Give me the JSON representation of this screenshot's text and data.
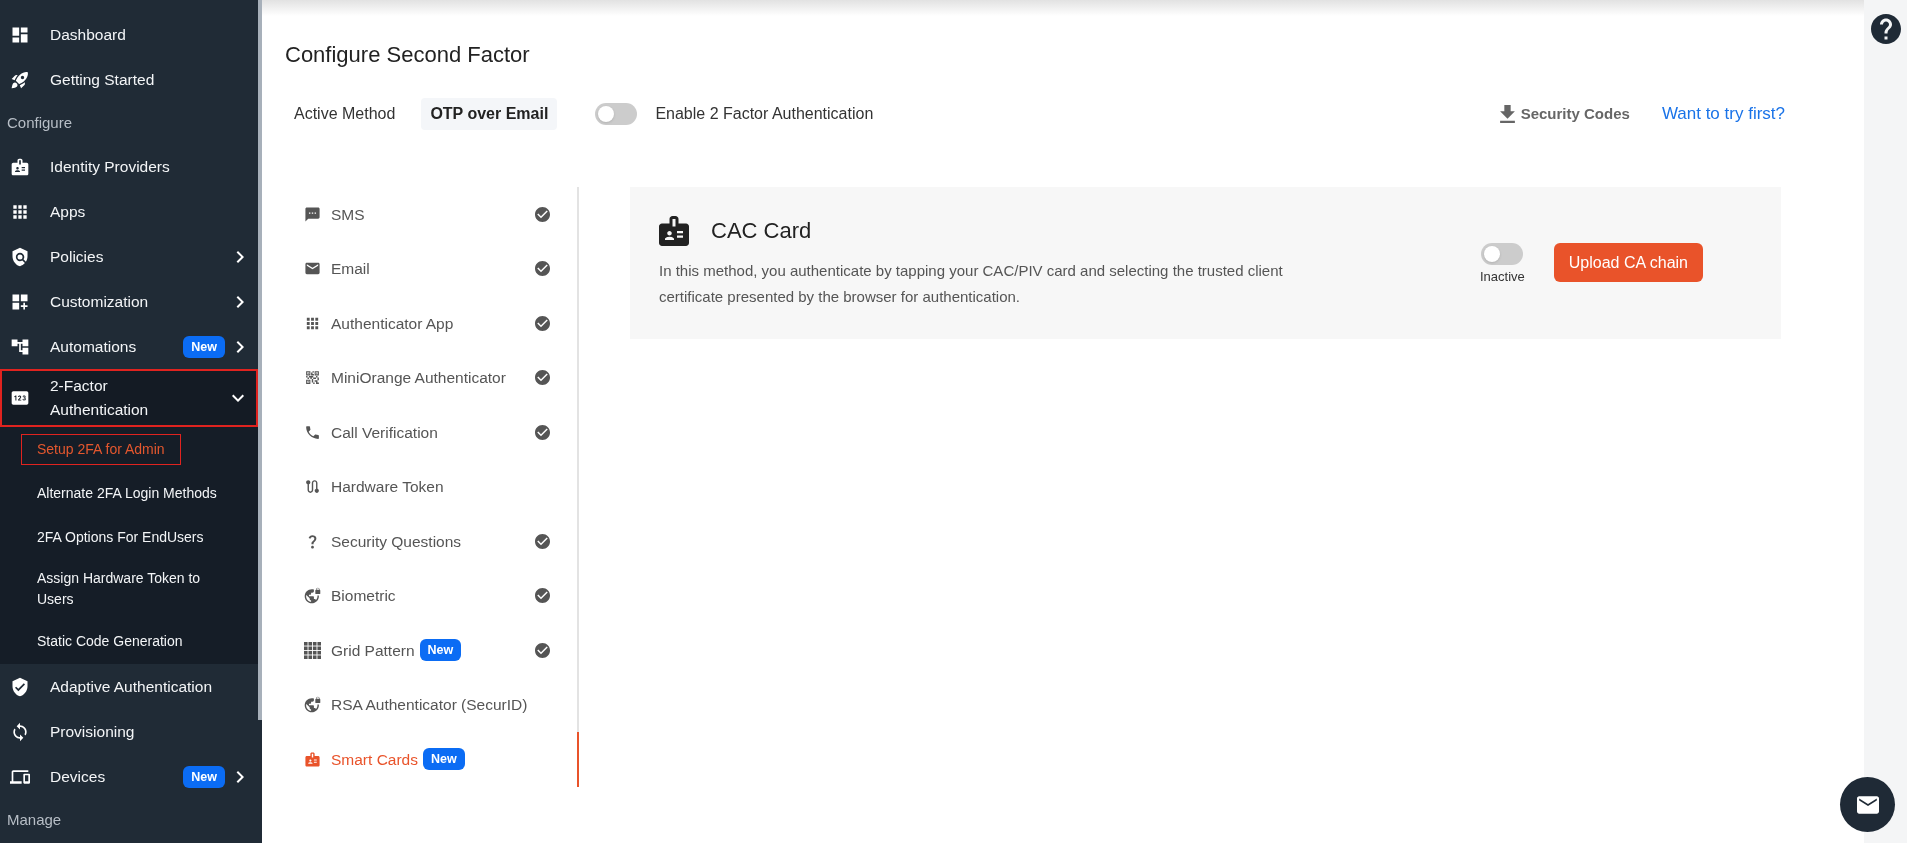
{
  "sidebar": {
    "items": [
      {
        "kind": "link",
        "label": "Dashboard",
        "selected": false
      },
      {
        "kind": "link",
        "label": "Getting Started",
        "selected": false
      },
      {
        "kind": "heading",
        "label": "Configure"
      },
      {
        "kind": "link",
        "label": "Identity Providers",
        "selected": false
      },
      {
        "kind": "link",
        "label": "Apps",
        "selected": false
      },
      {
        "kind": "group",
        "label": "Policies",
        "selected": false,
        "expanded": false
      },
      {
        "kind": "group",
        "label": "Customization",
        "selected": false,
        "expanded": false
      },
      {
        "kind": "group",
        "label": "Automations",
        "badge": "New",
        "selected": false,
        "expanded": false
      },
      {
        "kind": "group",
        "label": "2-Factor Authentication",
        "selected": true,
        "expanded": true,
        "children": [
          {
            "label": "Setup 2FA for Admin",
            "selected": true
          },
          {
            "label": "Alternate 2FA Login Methods",
            "selected": false
          },
          {
            "label": "2FA Options For EndUsers",
            "selected": false
          },
          {
            "label": "Assign Hardware Token to Users",
            "selected": false
          },
          {
            "label": "Static Code Generation",
            "selected": false
          }
        ]
      },
      {
        "kind": "link",
        "label": "Adaptive Authentication",
        "selected": false
      },
      {
        "kind": "link",
        "label": "Provisioning",
        "selected": false
      },
      {
        "kind": "group",
        "label": "Devices",
        "badge": "New",
        "selected": false,
        "expanded": false
      },
      {
        "kind": "heading",
        "label": "Manage"
      }
    ]
  },
  "page": {
    "title": "Configure Second Factor",
    "active_method": {
      "label": "Active Method",
      "value": "OTP over Email"
    },
    "enable_2fa": {
      "label": "Enable 2 Factor Authentication",
      "on": false
    },
    "security_codes": "Security Codes",
    "try_link": "Want to try first?"
  },
  "methods": [
    {
      "label": "SMS",
      "configured": true,
      "selected": false
    },
    {
      "label": "Email",
      "configured": true,
      "selected": false
    },
    {
      "label": "Authenticator App",
      "configured": true,
      "selected": false
    },
    {
      "label": "MiniOrange Authenticator",
      "configured": true,
      "selected": false
    },
    {
      "label": "Call Verification",
      "configured": true,
      "selected": false
    },
    {
      "label": "Hardware Token",
      "configured": false,
      "selected": false
    },
    {
      "label": "Security Questions",
      "configured": true,
      "selected": false
    },
    {
      "label": "Biometric",
      "configured": true,
      "selected": false
    },
    {
      "label": "Grid Pattern",
      "badge": "New",
      "configured": true,
      "selected": false
    },
    {
      "label": "RSA Authenticator (SecurID)",
      "configured": false,
      "selected": false
    },
    {
      "label": "Smart Cards",
      "badge": "New",
      "configured": false,
      "selected": true
    }
  ],
  "card": {
    "title": "CAC Card",
    "description": "In this method, you authenticate by tapping your CAC/PIV card and selecting the trusted client certificate presented by the browser for authentication.",
    "status": {
      "on": false,
      "label": "Inactive"
    },
    "button": "Upload CA chain"
  }
}
